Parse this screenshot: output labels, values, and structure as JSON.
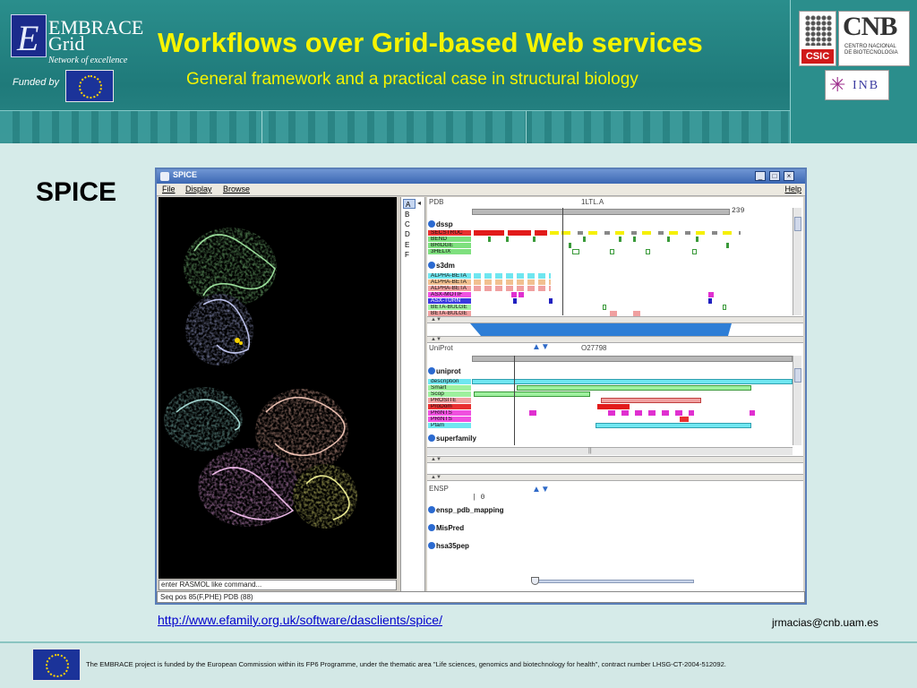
{
  "header": {
    "logo_line1": "EMBRACE",
    "logo_line2": "Grid",
    "logo_tagline": "Network of excellence",
    "funded_by": "Funded by",
    "title": "Workflows over Grid-based Web services",
    "subtitle": "General framework and a practical case in structural biology",
    "partner_logos": {
      "csic": "CSIC",
      "cnb": "CNB",
      "cnb_small": "CENTRO NACIONAL DE BIOTECNOLOGIA",
      "inb": "INB"
    }
  },
  "section_label": "SPICE",
  "app": {
    "window_title": "SPICE",
    "menus": [
      "File",
      "Display",
      "Browse"
    ],
    "help_label": "Help",
    "chains": [
      "A",
      "B",
      "C",
      "D",
      "E",
      "F"
    ],
    "selected_chain": "A",
    "rasmol_command_placeholder": "enter RASMOL like command...",
    "status_text": "Seq pos 85(F,PHE) PDB (88)",
    "pdb_panel": {
      "label": "PDB",
      "accession": "1LTL.A",
      "ruler_end": "239",
      "sources": [
        {
          "name": "dssp",
          "tracks": [
            "SECSTRUC",
            "BEND",
            "BRIDGE",
            "3HELIX"
          ]
        },
        {
          "name": "s3dm",
          "tracks": [
            "ALPHA-BETA",
            "ALPHA-BETA",
            "ALPHA-BETA",
            "ASX-MOTIF",
            "ASX-TURN",
            "BETA-BULGE",
            "BETA-BULGE"
          ]
        }
      ]
    },
    "uniprot_panel": {
      "label": "UniProt",
      "accession": "O27798",
      "sources": [
        {
          "name": "uniprot",
          "tracks": [
            "description",
            "Smart",
            "Scop",
            "PROSITE",
            "ProDom",
            "PRINTS",
            "PRINTS",
            "Pfam"
          ]
        },
        {
          "name": "superfamily",
          "tracks": []
        }
      ]
    },
    "ensp_panel": {
      "label": "ENSP",
      "ruler_start": "0",
      "sources": [
        "ensp_pdb_mapping",
        "MisPred",
        "hsa35pep"
      ]
    },
    "scroll_marker": "||"
  },
  "url": "http://www.efamily.org.uk/software/dasclients/spice/",
  "email": "jrmacias@cnb.uam.es",
  "footer_text": "The EMBRACE project is funded by the European Commission within its FP6 Programme, under the thematic area \"Life sciences, genomics and biotechnology for health\", contract number LHSG-CT-2004-512092.",
  "colors": {
    "title_yellow": "#f6f400",
    "header_teal": "#1f7a7a",
    "eu_blue": "#1b3399",
    "link_blue": "#0000cc"
  },
  "icons": [
    "eu-flag-icon",
    "csic-logo",
    "cnb-logo",
    "inb-logo",
    "das-source-icon",
    "up-arrow-icon",
    "down-arrow-icon"
  ]
}
